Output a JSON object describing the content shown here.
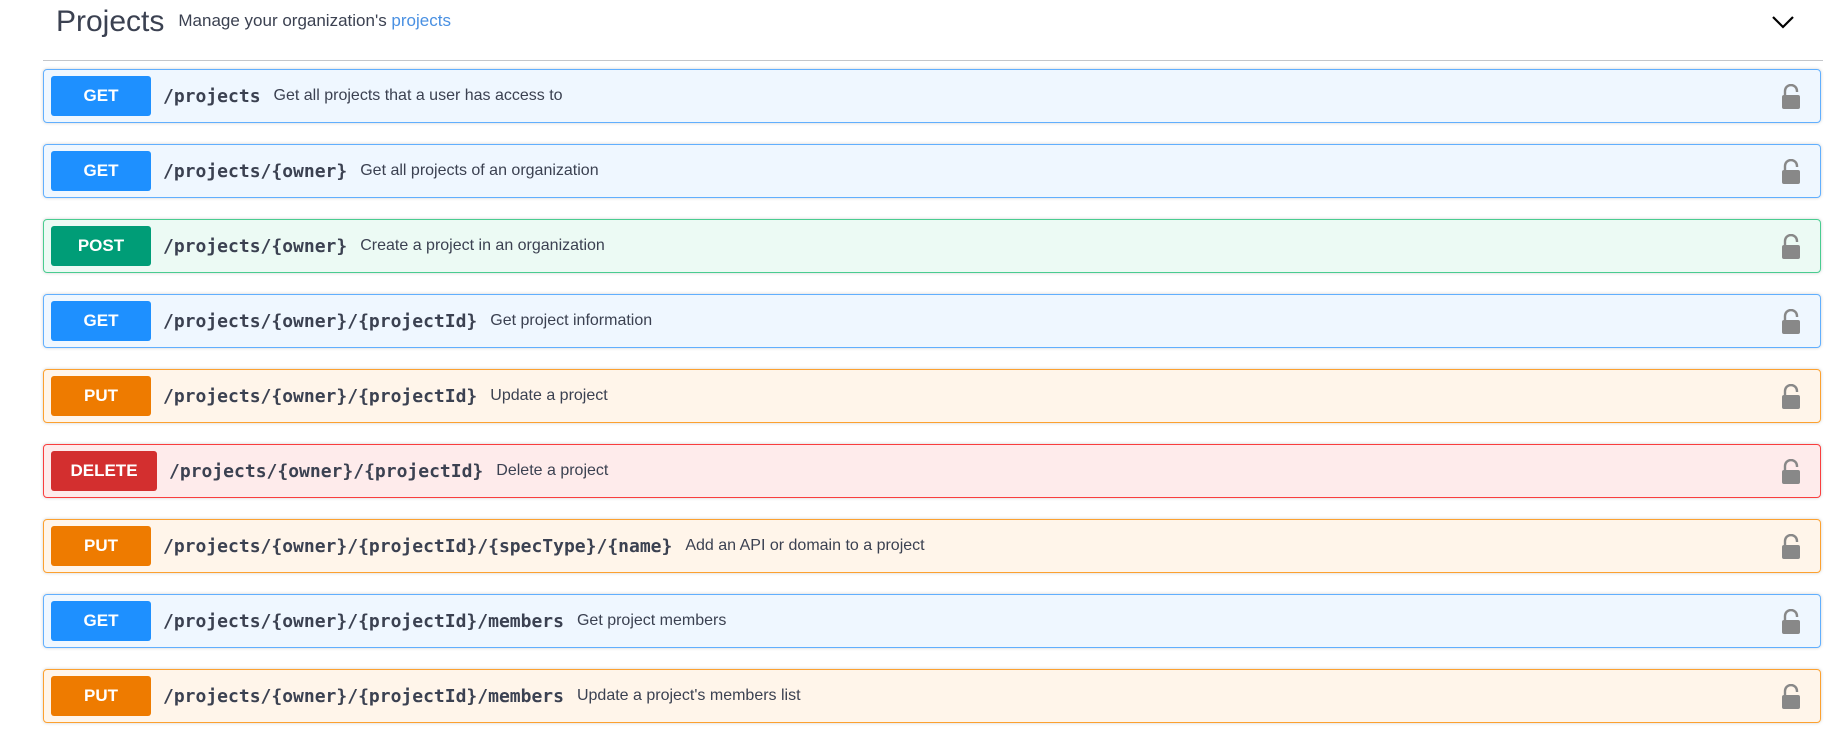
{
  "section": {
    "title": "Projects",
    "description_prefix": "Manage your organization's ",
    "description_link": "projects",
    "expanded": true
  },
  "colors": {
    "get": "#1e90ff",
    "post": "#009d77",
    "put": "#ee7b00",
    "delete": "#d32f2f",
    "link": "#4990e2",
    "text": "#3b4151"
  },
  "operations": [
    {
      "method": "GET",
      "path": "/projects",
      "summary": "Get all projects that a user has access to"
    },
    {
      "method": "GET",
      "path": "/projects/{owner}",
      "summary": "Get all projects of an organization"
    },
    {
      "method": "POST",
      "path": "/projects/{owner}",
      "summary": "Create a project in an organization"
    },
    {
      "method": "GET",
      "path": "/projects/{owner}/{projectId}",
      "summary": "Get project information"
    },
    {
      "method": "PUT",
      "path": "/projects/{owner}/{projectId}",
      "summary": "Update a project"
    },
    {
      "method": "DELETE",
      "path": "/projects/{owner}/{projectId}",
      "summary": "Delete a project"
    },
    {
      "method": "PUT",
      "path": "/projects/{owner}/{projectId}/{specType}/{name}",
      "summary": "Add an API or domain to a project"
    },
    {
      "method": "GET",
      "path": "/projects/{owner}/{projectId}/members",
      "summary": "Get project members"
    },
    {
      "method": "PUT",
      "path": "/projects/{owner}/{projectId}/members",
      "summary": "Update a project's members list"
    }
  ],
  "icons": {
    "toggle": "chevron-down-icon",
    "auth": "lock-icon"
  }
}
